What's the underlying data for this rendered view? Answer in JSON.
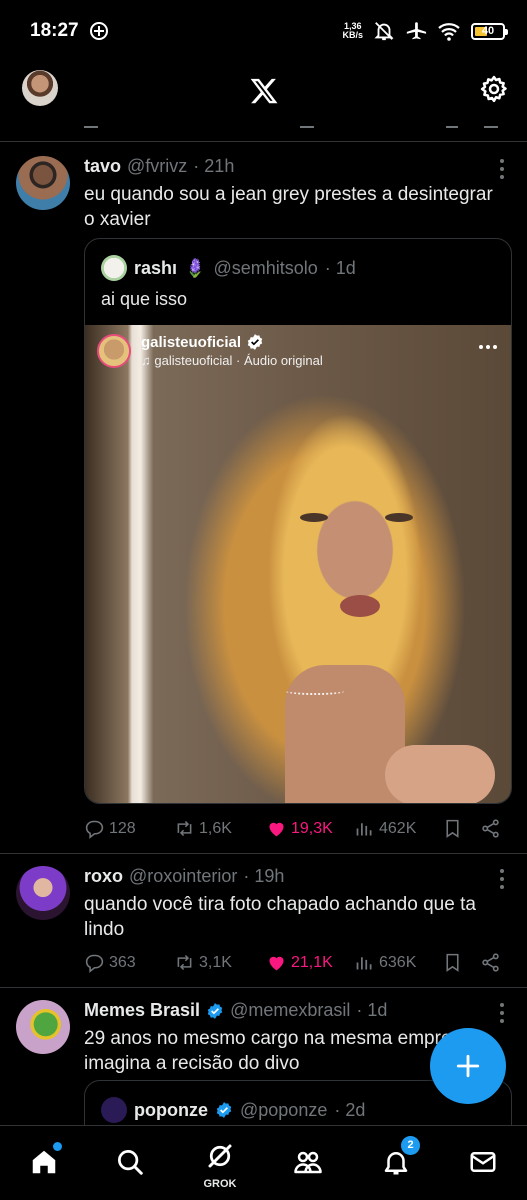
{
  "status_bar": {
    "time": "18:27",
    "net_speed_value": "1,36",
    "net_speed_unit": "KB/s",
    "battery": "40"
  },
  "tweets": [
    {
      "name": "tavo",
      "handle": "@fvrivz",
      "time": "· 21h",
      "text": "eu quando sou a jean grey prestes a desintegrar o xavier",
      "quote": {
        "name": "rashı",
        "emoji": "🪻",
        "handle": "@semhitsolo",
        "time": "· 1d",
        "text": "ai que isso",
        "media": {
          "user": "galisteuoficial",
          "audio": "♫ galisteuoficial · Áudio original"
        }
      },
      "stats": {
        "replies": "128",
        "reposts": "1,6K",
        "likes": "19,3K",
        "views": "462K"
      }
    },
    {
      "name": "roxo",
      "handle": "@roxointerior",
      "time": "· 19h",
      "text": "quando você tira foto chapado achando que ta lindo",
      "stats": {
        "replies": "363",
        "reposts": "3,1K",
        "likes": "21,1K",
        "views": "636K"
      }
    },
    {
      "name": "Memes Brasil",
      "handle": "@memexbrasil",
      "time": "· 1d",
      "text": "29 anos no mesmo cargo na mesma empres\nimagina a recisão do divo",
      "quote": {
        "name": "poponze",
        "handle": "@poponze",
        "time": "· 2d"
      }
    }
  ],
  "bottom_nav": {
    "grok_label": "GROK",
    "notifications_badge": "2"
  },
  "colors": {
    "accent": "#1d9bf0",
    "like": "#f91880",
    "secondary_text": "#71767b",
    "divider": "#2f3336"
  }
}
